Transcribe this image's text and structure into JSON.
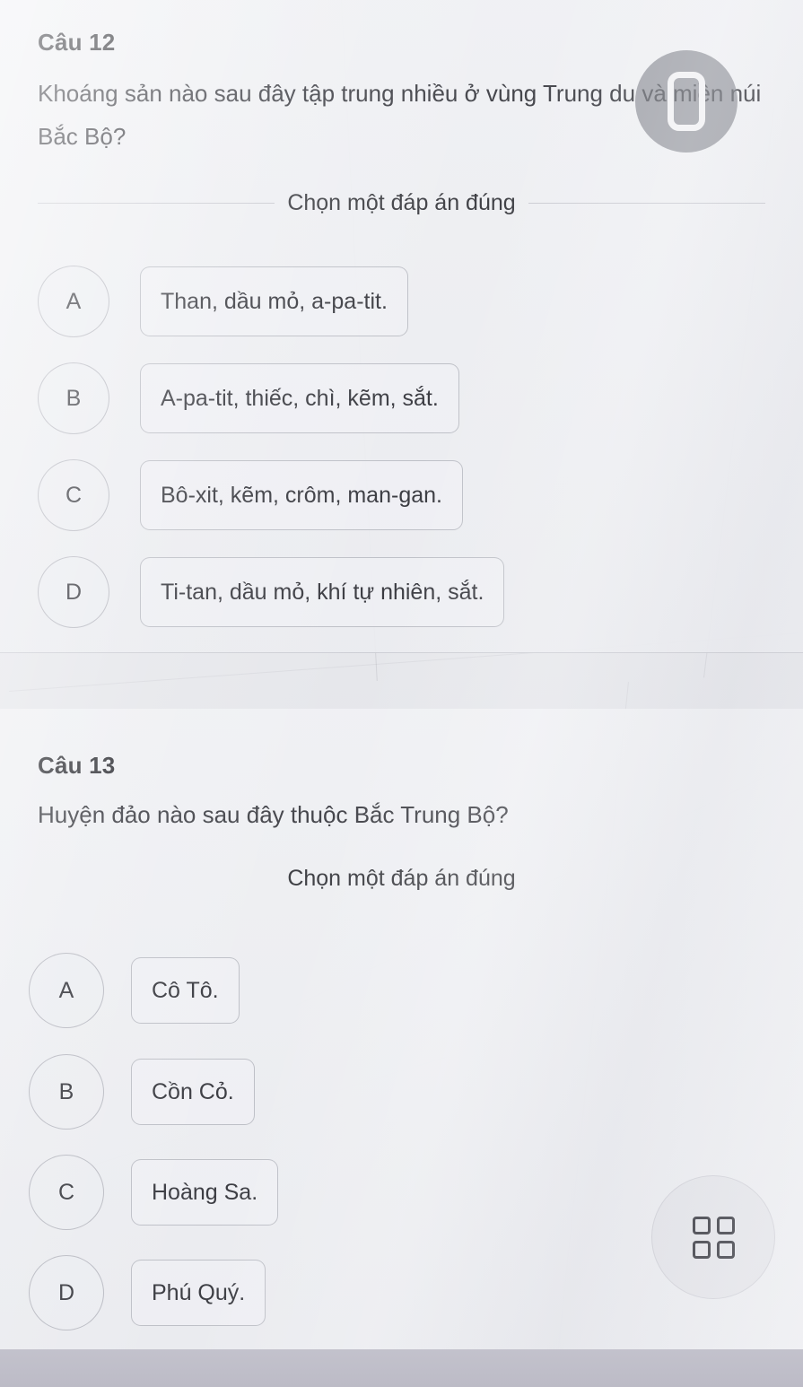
{
  "questions": [
    {
      "number_label": "Câu 12",
      "text": "Khoáng sản nào sau đây tập trung nhiều ở vùng Trung du và miền núi Bắc Bộ?",
      "hint": "Chọn một đáp án đúng",
      "options": [
        {
          "letter": "A",
          "text": "Than, dầu mỏ, a-pa-tit."
        },
        {
          "letter": "B",
          "text": "A-pa-tit, thiếc, chì, kẽm, sắt."
        },
        {
          "letter": "C",
          "text": "Bô-xit, kẽm, crôm, man-gan."
        },
        {
          "letter": "D",
          "text": "Ti-tan, dầu mỏ, khí tự nhiên, sắt."
        }
      ]
    },
    {
      "number_label": "Câu 13",
      "text": "Huyện đảo nào sau đây thuộc Bắc Trung Bộ?",
      "hint": "Chọn một đáp án đúng",
      "options": [
        {
          "letter": "A",
          "text": "Cô Tô."
        },
        {
          "letter": "B",
          "text": "Cồn Cỏ."
        },
        {
          "letter": "C",
          "text": "Hoàng Sa."
        },
        {
          "letter": "D",
          "text": "Phú Quý."
        }
      ]
    }
  ],
  "overlays": {
    "recorder_icon": "phone-device-icon",
    "apps_icon": "apps-grid-icon"
  },
  "colors": {
    "page_background": "#e8e9ed",
    "card_background": "#f0f1f4",
    "text": "#3b3c42",
    "border": "#9699a3",
    "watermark": "#787a82"
  }
}
